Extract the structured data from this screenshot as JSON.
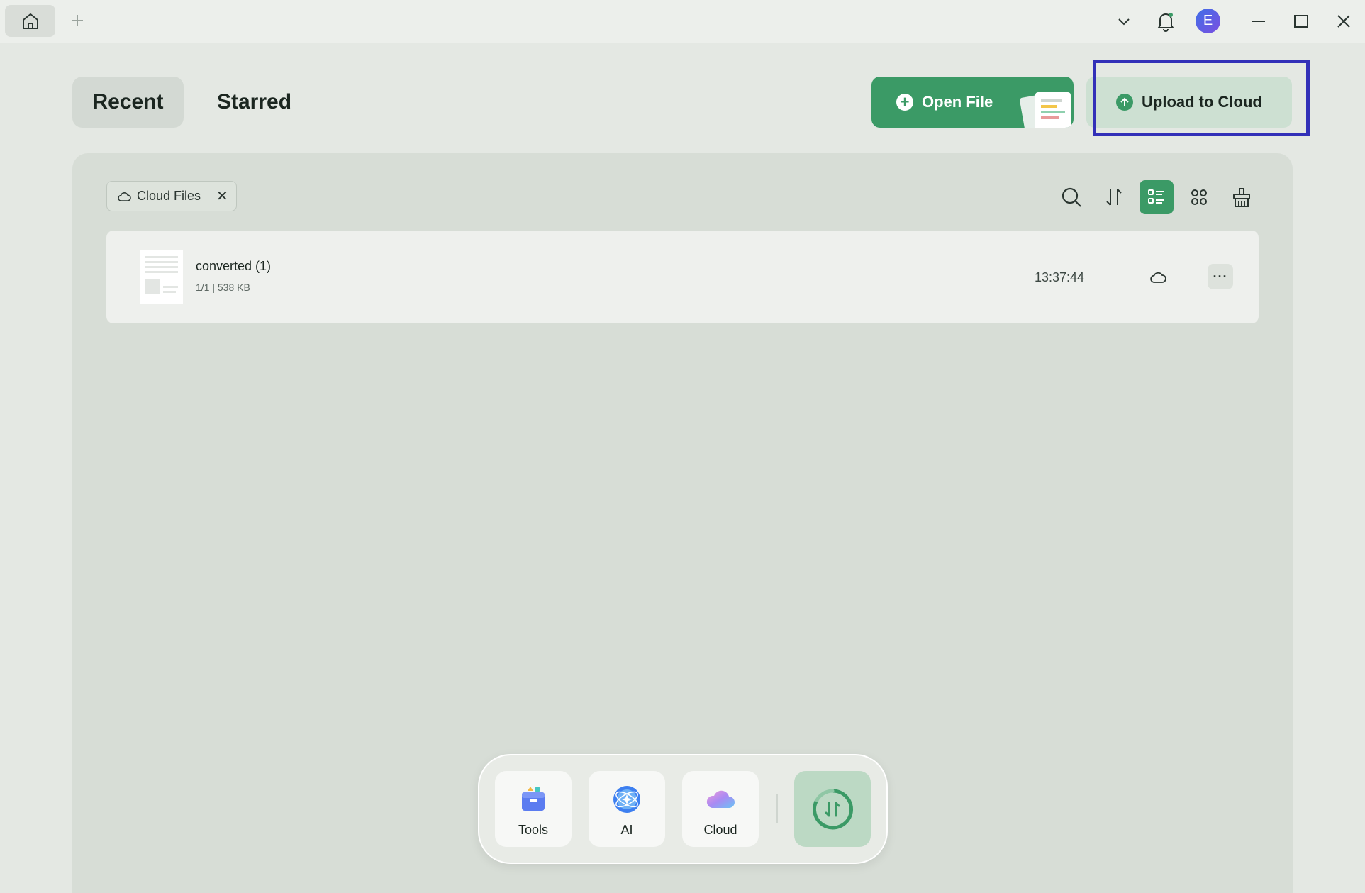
{
  "titlebar": {
    "icons": [
      "home-icon",
      "plus-icon",
      "chevron-down-icon",
      "bell-icon",
      "minimize-icon",
      "maximize-icon",
      "close-icon"
    ],
    "avatar_letter": "E"
  },
  "tabs": {
    "recent": "Recent",
    "starred": "Starred"
  },
  "actions": {
    "open_file": "Open File",
    "upload_to_cloud": "Upload to Cloud"
  },
  "filter_chip": {
    "label": "Cloud Files",
    "close": "✕"
  },
  "toolbar": {
    "icons": [
      "search-icon",
      "sort-icon",
      "list-view-icon",
      "grid-view-icon",
      "clear-icon"
    ],
    "active_view": "list"
  },
  "files": [
    {
      "name": "converted (1)",
      "meta": "1/1 | 538 KB",
      "time": "13:37:44",
      "more": "···"
    }
  ],
  "dock": {
    "items": [
      {
        "label": "Tools",
        "icon": "tools-icon"
      },
      {
        "label": "AI",
        "icon": "ai-icon"
      },
      {
        "label": "Cloud",
        "icon": "cloud-icon"
      }
    ],
    "convert_icon": "convert-icon"
  },
  "colors": {
    "accent": "#3b9a66",
    "highlight_outline": "#3230b8",
    "background": "#e4e8e3"
  }
}
